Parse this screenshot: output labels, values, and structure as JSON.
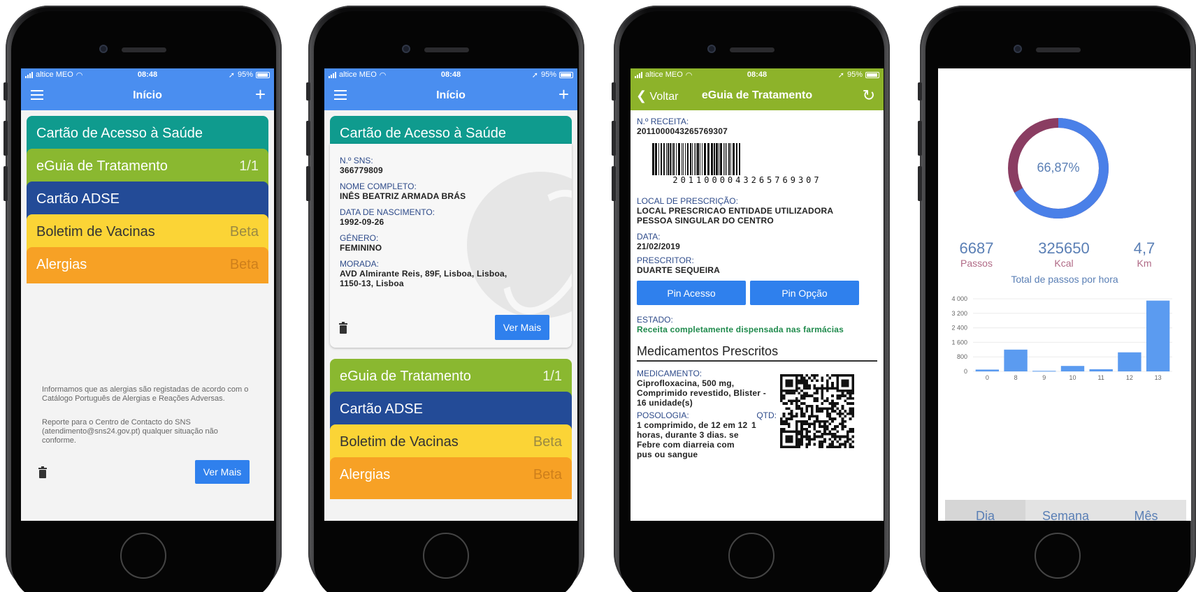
{
  "phone1": {
    "status": {
      "carrier": "altice MEO",
      "time": "08:48",
      "battery": "95%"
    },
    "nav_title": "Início",
    "cards": [
      {
        "label": "Cartão de Acesso à Saúde",
        "badge": ""
      },
      {
        "label": "eGuia de Tratamento",
        "badge": "1/1"
      },
      {
        "label": "Cartão ADSE",
        "badge": ""
      },
      {
        "label": "Boletim de Vacinas",
        "badge": "Beta"
      },
      {
        "label": "Alergias",
        "badge": "Beta"
      }
    ],
    "note1": "Informamos que as alergias são registadas de acordo com o Catálogo Português de Alergias e Reações Adversas.",
    "note2": "Reporte para o Centro de Contacto do SNS (atendimento@sns24.gov.pt) qualquer situação não conforme.",
    "ver_mais": "Ver Mais"
  },
  "phone2": {
    "status": {
      "carrier": "altice MEO",
      "time": "08:48",
      "battery": "95%"
    },
    "nav_title": "Início",
    "card_title": "Cartão de Acesso à Saúde",
    "fields": [
      {
        "label": "N.º SNS:",
        "value": "366779809"
      },
      {
        "label": "NOME COMPLETO:",
        "value": "INÊS BEATRIZ ARMADA BRÁS"
      },
      {
        "label": "DATA DE NASCIMENTO:",
        "value": "1992-09-26"
      },
      {
        "label": "GÉNERO:",
        "value": "FEMININO"
      },
      {
        "label": "MORADA:",
        "value": "AVD Almirante Reis, 89F, Lisboa, Lisboa, 1150-13, Lisboa"
      }
    ],
    "ver_mais": "Ver Mais",
    "cards": [
      {
        "label": "eGuia de Tratamento",
        "badge": "1/1"
      },
      {
        "label": "Cartão ADSE",
        "badge": ""
      },
      {
        "label": "Boletim de Vacinas",
        "badge": "Beta"
      },
      {
        "label": "Alergias",
        "badge": "Beta"
      }
    ]
  },
  "phone3": {
    "status": {
      "carrier": "altice MEO",
      "time": "08:48",
      "battery": "95%"
    },
    "back": "Voltar",
    "nav_title": "eGuia de Tratamento",
    "receita_label": "N.º RECEITA:",
    "receita_value": "2011000043265769307",
    "barcode_digits": "2011000043265769307",
    "local_label": "LOCAL DE PRESCRIÇÃO:",
    "local_value": "LOCAL PRESCRICAO ENTIDADE UTILIZADORA PESSOA SINGULAR DO CENTRO",
    "data_label": "DATA:",
    "data_value": "21/02/2019",
    "prescritor_label": "PRESCRITOR:",
    "prescritor_value": "DUARTE SEQUEIRA",
    "pin_acesso": "Pin Acesso",
    "pin_opcao": "Pin Opção",
    "estado_label": "ESTADO:",
    "estado_value": "Receita completamente dispensada nas farmácias",
    "section_title": "Medicamentos Prescritos",
    "med_label": "MEDICAMENTO:",
    "med_value": "Ciprofloxacina, 500 mg, Comprimido revestido, Blister - 16 unidade(s)",
    "posologia_label": "POSOLOGIA:",
    "qtd_label": "QTD:",
    "qtd_value": "1",
    "posologia_value": "1 comprimido, de 12 em 12 horas, durante 3 dias. se Febre com diarreia com pus ou sangue",
    "colors": {
      "accent_green": "#8db32a",
      "status_green": "#1f8a4c"
    }
  },
  "phone4": {
    "percent": "66,87%",
    "progress": 0.6687,
    "stats": [
      {
        "value": "6687",
        "label": "Passos"
      },
      {
        "value": "325650",
        "label": "Kcal"
      },
      {
        "value": "4,7",
        "label": "Km"
      }
    ],
    "segments": [
      "Dia",
      "Semana",
      "Mês"
    ],
    "active_segment": "Dia"
  },
  "chart_data": {
    "type": "bar",
    "title": "Total de passos por hora",
    "categories": [
      "0",
      "8",
      "9",
      "10",
      "11",
      "12",
      "13"
    ],
    "values": [
      100,
      1200,
      30,
      300,
      120,
      1050,
      3900
    ],
    "ylim": [
      0,
      4000
    ],
    "yticks": [
      "0",
      "800",
      "1 600",
      "2 400",
      "3 200",
      "4 000"
    ],
    "ytick_values": [
      0,
      800,
      1600,
      2400,
      3200,
      4000
    ],
    "xlabel": "",
    "ylabel": "",
    "grid": true,
    "bar_color": "#5b9bf0"
  }
}
